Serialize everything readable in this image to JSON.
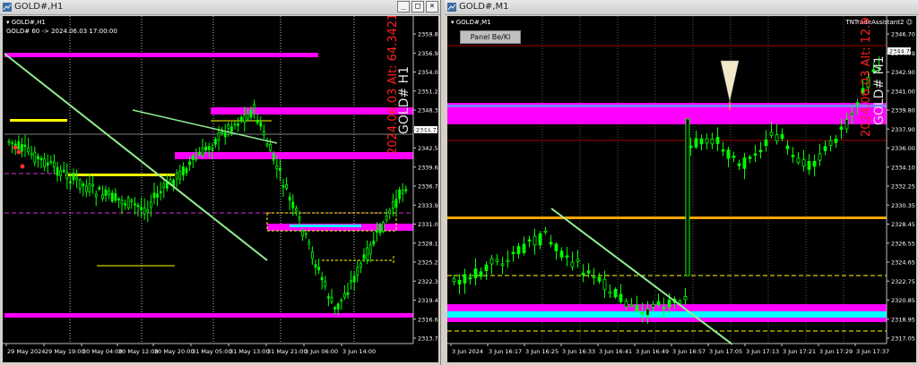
{
  "windows": [
    {
      "title": "GOLD#,H1",
      "symbol_label": "GOLD#,H1",
      "info_line": "GOLD# 60 -> 2024.06.03 17:00:00",
      "vertical_text_red": "2024.06.03 Alt: 64.3421",
      "vertical_text_white": "GOLD# H1",
      "price_labels": [
        "2359.85",
        "2356.95",
        "2354.05",
        "2351.20",
        "2348.30",
        "2345.40",
        "2342.55",
        "2339.65",
        "2336.75",
        "2333.90",
        "2331.00",
        "2328.10",
        "2325.25",
        "2322.35",
        "2319.45",
        "2316.60",
        "2313.70"
      ],
      "current_price": "2344.75",
      "time_labels": [
        "29 May 2024",
        "29 May 19:00",
        "30 May 04:00",
        "30 May 12:00",
        "30 May 20:00",
        "31 May 05:00",
        "31 May 13:00",
        "31 May 21:00",
        "3 Jun 06:00",
        "3 Jun 14:00"
      ],
      "colors": {
        "bull": "#00ff00",
        "bear": "#00ff00",
        "zone": "#ff00ff",
        "trend": "#90ee90",
        "level_yellow": "#ffff00",
        "cyan": "#00ffff"
      }
    },
    {
      "title": "GOLD#,M1",
      "symbol_label": "GOLD#,M1",
      "panel_button": "Panel Be/Kl",
      "ea_label": "TNTradeAssistant2",
      "vertical_text_red": "2024.06.03 Alt: 12.9",
      "vertical_text_white": "GOLD# M1",
      "price_labels": [
        "2346.70",
        "2344.79",
        "2342.90",
        "2341.00",
        "2339.80",
        "2337.90",
        "2336.00",
        "2334.10",
        "2332.25",
        "2330.35",
        "2328.45",
        "2326.55",
        "2324.65",
        "2322.75",
        "2320.85",
        "2318.95",
        "2317.05"
      ],
      "current_price": "2344.79",
      "time_labels": [
        "3 Jun 2024",
        "3 Jun 16:17",
        "3 Jun 16:25",
        "3 Jun 16:33",
        "3 Jun 16:41",
        "3 Jun 16:49",
        "3 Jun 16:57",
        "3 Jun 17:05",
        "3 Jun 17:13",
        "3 Jun 17:21",
        "3 Jun 17:29",
        "3 Jun 17:37"
      ],
      "colors": {
        "candle": "#00ff00",
        "zone": "#ff00ff",
        "cyan": "#00ffff",
        "orange": "#ffa500",
        "red_line": "#8b0000",
        "trend": "#90ee90"
      }
    }
  ]
}
